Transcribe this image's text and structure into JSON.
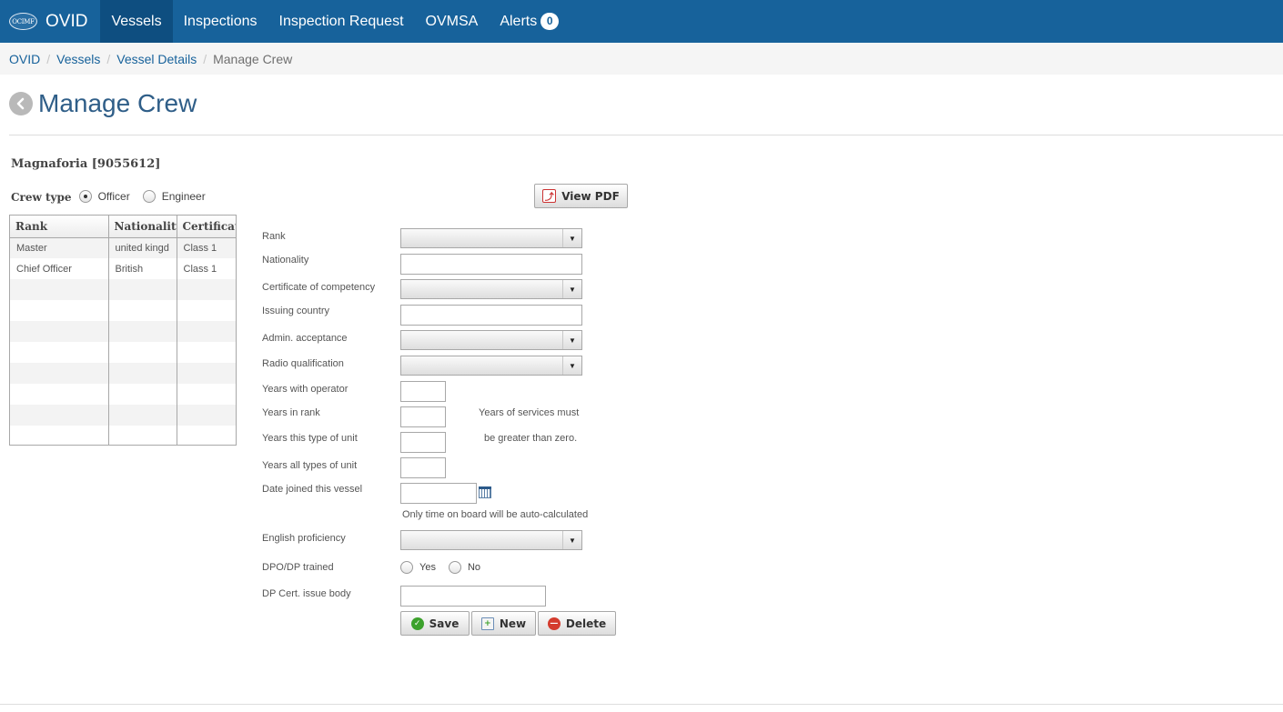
{
  "nav": {
    "logo_text": "OCIMF",
    "brand": "OVID",
    "items": [
      {
        "label": "Vessels"
      },
      {
        "label": "Inspections"
      },
      {
        "label": "Inspection Request"
      },
      {
        "label": "OVMSA"
      },
      {
        "label": "Alerts"
      }
    ],
    "alerts_count": "0"
  },
  "breadcrumb": [
    "OVID",
    "Vessels",
    "Vessel Details",
    "Manage Crew"
  ],
  "page": {
    "title": "Manage Crew",
    "vessel": "Magnaforia [9055612]"
  },
  "crew_type": {
    "label": "Crew type",
    "options": [
      "Officer",
      "Engineer"
    ],
    "selected": "Officer"
  },
  "grid": {
    "headers": [
      "Rank",
      "Nationality",
      "Certificate"
    ],
    "rows": [
      [
        "Master",
        "united kingd",
        "Class 1"
      ],
      [
        "Chief Officer",
        "British",
        "Class 1"
      ]
    ]
  },
  "buttons": {
    "view_pdf": "View PDF",
    "save": "Save",
    "new": "New",
    "delete": "Delete"
  },
  "form": {
    "rank": "Rank",
    "nationality": "Nationality",
    "certificate": "Certificate of competency",
    "issuing_country": "Issuing country",
    "admin_acceptance": "Admin. acceptance",
    "radio_qualification": "Radio qualification",
    "years_operator": "Years with operator",
    "years_rank": "Years in rank",
    "years_type": "Years this type of unit",
    "years_all": "Years all types of unit",
    "date_joined": "Date joined this vessel",
    "english": "English proficiency",
    "dpo_trained": "DPO/DP trained",
    "dpo_yes": "Yes",
    "dpo_no": "No",
    "dp_cert_body": "DP Cert. issue body",
    "note_years_1": "Years of services must",
    "note_years_2": "be greater than zero.",
    "note_date": "Only time on board will be auto-calculated"
  }
}
